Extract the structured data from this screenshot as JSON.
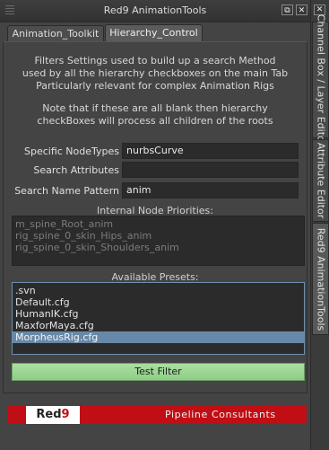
{
  "window": {
    "title": "Red9 AnimationTools",
    "float_icon": "float-icon",
    "close_icon": "close-icon"
  },
  "tabs": [
    {
      "label": "Animation_Toolkit",
      "active": false
    },
    {
      "label": "Hierarchy_Control",
      "active": true
    }
  ],
  "info": {
    "line1": "Filters Settings used to build up a search Method",
    "line2": "used by all the hierarchy checkboxes on the main Tab",
    "line3": "Particularly relevant for complex Animation Rigs",
    "line4": "Note that if these are all blank then hierarchy",
    "line5": "checkBoxes will process all children of the roots"
  },
  "fields": {
    "node_types_label": "Specific NodeTypes",
    "node_types_value": "nurbsCurve",
    "search_attrs_label": "Search Attributes",
    "search_attrs_value": "",
    "name_pattern_label": "Search Name Pattern",
    "name_pattern_value": "anim"
  },
  "priorities": {
    "label": "Internal Node Priorities:",
    "items": [
      "m_spine_Root_anim",
      "rig_spine_0_skin_Hips_anim",
      "rig_spine_0_skin_Shoulders_anim"
    ]
  },
  "presets": {
    "label": "Available Presets:",
    "items": [
      ".svn",
      "Default.cfg",
      "HumanIK.cfg",
      "MaxforMaya.cfg",
      "MorpheusRig.cfg"
    ],
    "selected": "MorpheusRig.cfg"
  },
  "test_button": "Test Filter",
  "banner": {
    "logo_red": "Red",
    "logo_nine": "9",
    "text": "Pipeline Consultants"
  },
  "side_tabs": [
    {
      "label": "Channel Box / Layer Editor",
      "active": false
    },
    {
      "label": "Attribute Editor",
      "active": false
    },
    {
      "label": "Red9 AnimationTools",
      "active": true
    }
  ],
  "colors": {
    "background": "#444444",
    "selection": "#6788a8",
    "test_button": "#9bd893",
    "banner": "#c10e14"
  }
}
